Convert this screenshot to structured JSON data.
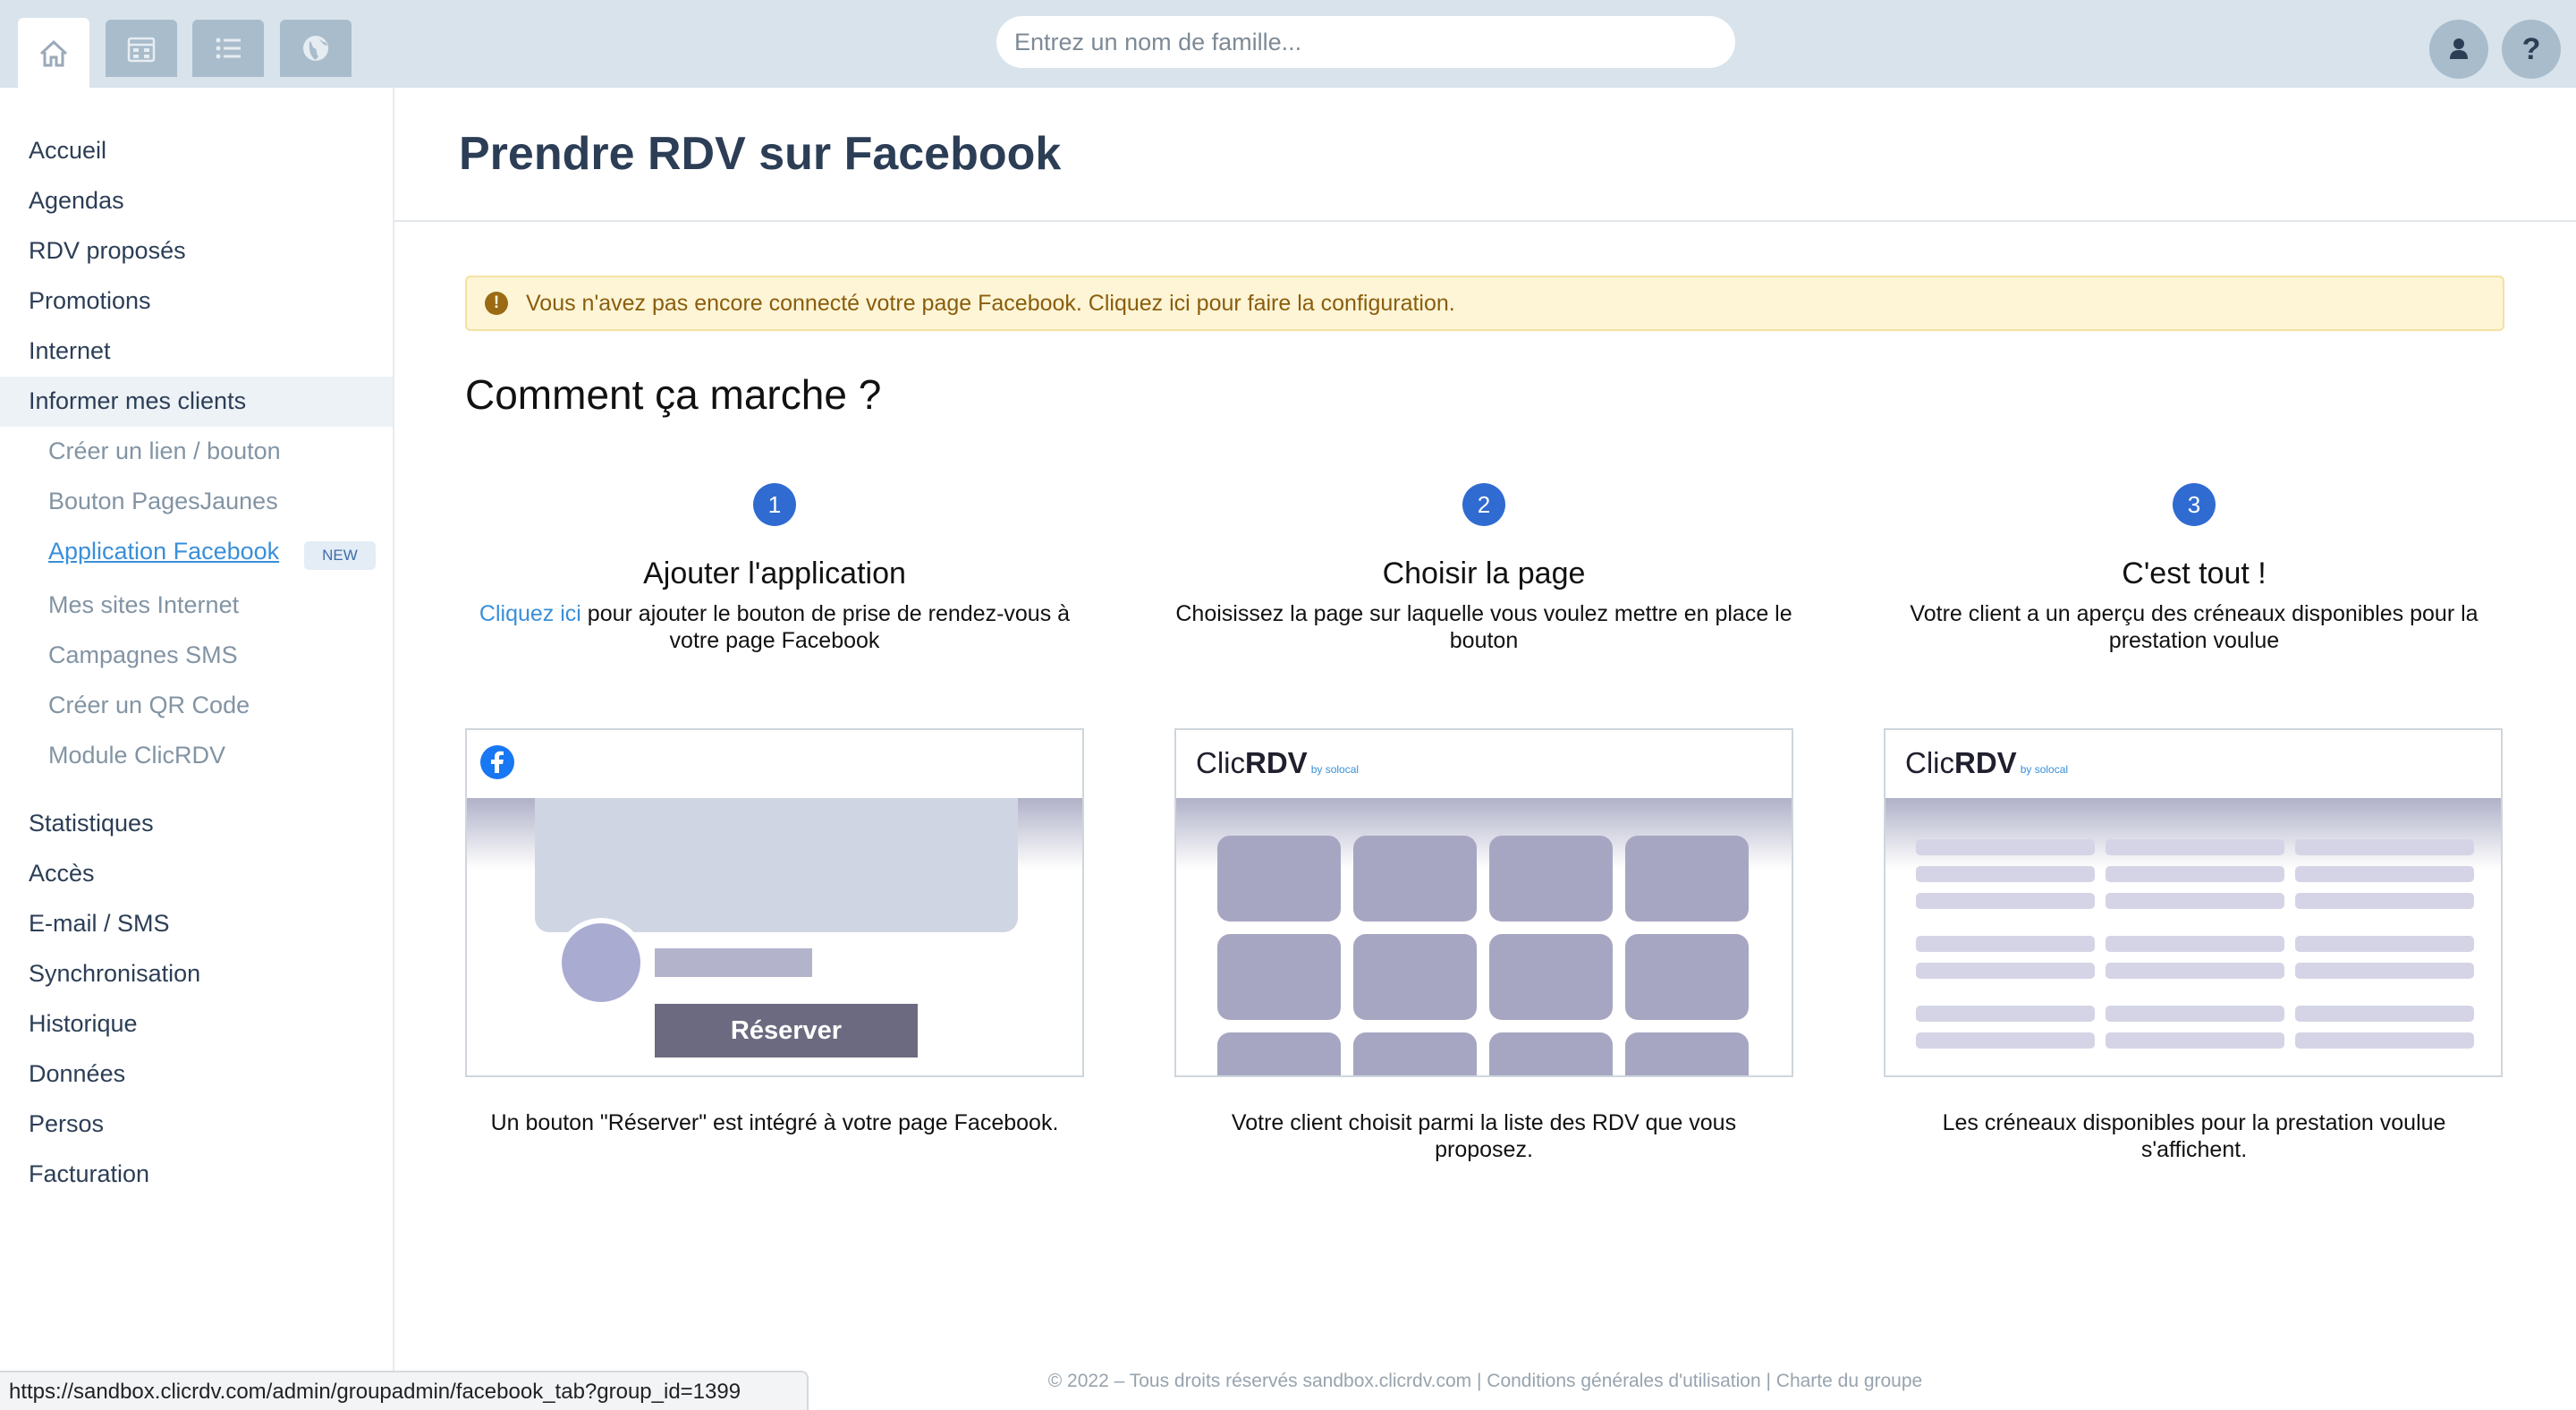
{
  "search": {
    "placeholder": "Entrez un nom de famille..."
  },
  "topbar": {
    "tabs": [
      "home-icon",
      "calendar-icon",
      "list-icon",
      "globe-icon"
    ],
    "user_icon": "user-icon",
    "help_label": "?"
  },
  "sidebar": {
    "items": [
      {
        "label": "Accueil"
      },
      {
        "label": "Agendas"
      },
      {
        "label": "RDV proposés"
      },
      {
        "label": "Promotions"
      },
      {
        "label": "Internet"
      },
      {
        "label": "Informer mes clients"
      }
    ],
    "sub_items": [
      {
        "label": "Créer un lien / bouton"
      },
      {
        "label": "Bouton PagesJaunes"
      },
      {
        "label": "Application Facebook"
      },
      {
        "label": "Mes sites Internet"
      },
      {
        "label": "Campagnes SMS"
      },
      {
        "label": "Créer un QR Code"
      },
      {
        "label": "Module ClicRDV"
      }
    ],
    "new_badge": "NEW",
    "items_bottom": [
      {
        "label": "Statistiques"
      },
      {
        "label": "Accès"
      },
      {
        "label": "E-mail / SMS"
      },
      {
        "label": "Synchronisation"
      },
      {
        "label": "Historique"
      },
      {
        "label": "Données"
      },
      {
        "label": "Persos"
      },
      {
        "label": "Facturation"
      }
    ]
  },
  "main": {
    "title": "Prendre RDV sur Facebook",
    "alert": {
      "text_before": "Vous n'avez pas encore connecté votre page Facebook. ",
      "link": "Cliquez ici pour faire la configuration."
    },
    "section_title": "Comment ça marche ?",
    "steps": [
      {
        "num": "1",
        "title": "Ajouter l'application",
        "link": "Cliquez ici",
        "desc": " pour ajouter le bouton de prise de rendez-vous à votre page Facebook",
        "caption": "Un bouton \"Réserver\" est intégré à votre page Facebook."
      },
      {
        "num": "2",
        "title": "Choisir la page",
        "desc": "Choisissez la page sur laquelle vous voulez mettre en place le bouton",
        "caption": "Votre client choisit parmi la liste des RDV que vous proposez."
      },
      {
        "num": "3",
        "title": "C'est tout !",
        "desc": "Votre client a un aperçu des créneaux disponibles pour la prestation voulue",
        "caption": "Les créneaux disponibles pour la prestation voulue s'affichent."
      }
    ],
    "illustration": {
      "reserve_button": "Réserver",
      "logo_light": "Clic",
      "logo_bold": "RDV",
      "logo_small": "by solocal"
    }
  },
  "footer": {
    "text": "© 2022 – Tous droits réservés sandbox.clicrdv.com | Conditions générales d'utilisation | Charte du groupe"
  },
  "statusbar": {
    "url": "https://sandbox.clicrdv.com/admin/groupadmin/facebook_tab?group_id=1399"
  }
}
